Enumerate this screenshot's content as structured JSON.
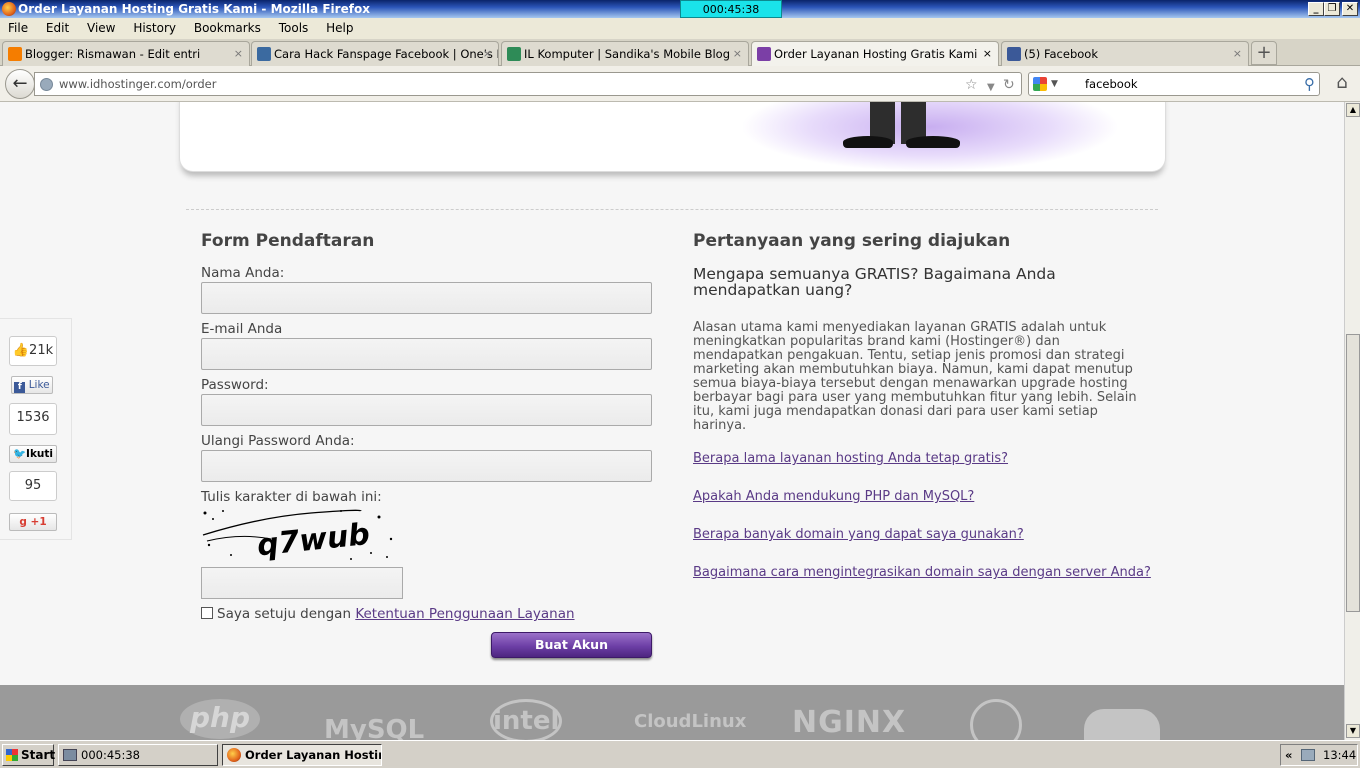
{
  "window": {
    "title": "Order Layanan Hosting Gratis Kami - Mozilla Firefox",
    "timer": "000:45:38",
    "min_label": "_",
    "max_label": "❐",
    "close_label": "✕"
  },
  "menu": [
    "File",
    "Edit",
    "View",
    "History",
    "Bookmarks",
    "Tools",
    "Help"
  ],
  "tabs": [
    {
      "label": "Blogger: Rismawan - Edit entri",
      "icon_color": "#f57d00",
      "close": "×"
    },
    {
      "label": "Cara Hack Fanspage Facebook | One's M...",
      "icon_color": "#3b6aa0",
      "close": "×"
    },
    {
      "label": "IL Komputer | Sandika's Mobile Blog",
      "icon_color": "#2e8b57",
      "close": "×"
    },
    {
      "label": "Order Layanan Hosting Gratis Kami",
      "icon_color": "#7b3fa6",
      "close": "×"
    },
    {
      "label": "(5) Facebook",
      "icon_color": "#3b5998",
      "close": "×"
    }
  ],
  "newtab": "+",
  "nav": {
    "url_domain": "www.idhostinger.com",
    "url_path": "/order",
    "search_text": "facebook"
  },
  "page": {
    "form_title": "Form Pendaftaran",
    "faq_title": "Pertanyaan yang sering diajukan",
    "fields": [
      {
        "label": "Nama Anda:"
      },
      {
        "label": "E-mail Anda"
      },
      {
        "label": "Password:"
      },
      {
        "label": "Ulangi Password Anda:"
      }
    ],
    "captcha_label": "Tulis karakter di bawah ini:",
    "captcha_text": "q7wub",
    "agree_text": "Saya setuju dengan",
    "agree_link": "Ketentuan Penggunaan Layanan",
    "submit_label": "Buat Akun",
    "faq_question": "Mengapa semuanya GRATIS? Bagaimana Anda mendapatkan uang?",
    "faq_body": "Alasan utama kami menyediakan layanan GRATIS adalah untuk meningkatkan popularitas brand kami (Hostinger®) dan mendapatkan pengakuan. Tentu, setiap jenis promosi dan strategi marketing akan membutuhkan biaya. Namun, kami dapat menutup semua biaya-biaya tersebut dengan menawarkan upgrade hosting berbayar bagi para user yang membutuhkan fitur yang lebih. Selain itu, kami juga mendapatkan donasi dari para user kami setiap harinya.",
    "faq_links": [
      "Berapa lama layanan hosting Anda tetap gratis?",
      "Apakah Anda mendukung PHP dan MySQL?",
      "Berapa banyak domain yang dapat saya gunakan?",
      "Bagaimana cara mengintegrasikan domain saya dengan server Anda?"
    ],
    "social": {
      "fb_count": "21k",
      "fb_label": "Like",
      "tw_count": "1536",
      "tw_label": "Ikuti",
      "gp_count": "95",
      "gp_label": "+1"
    },
    "logos": [
      "php",
      "MySQL",
      "intel",
      "CloudLinux",
      "NGINX"
    ]
  },
  "taskbar": {
    "start": "Start",
    "items": [
      "000:45:38",
      "Order Layanan Hostin..."
    ],
    "tray_chevron": "«",
    "clock": "13:44"
  }
}
